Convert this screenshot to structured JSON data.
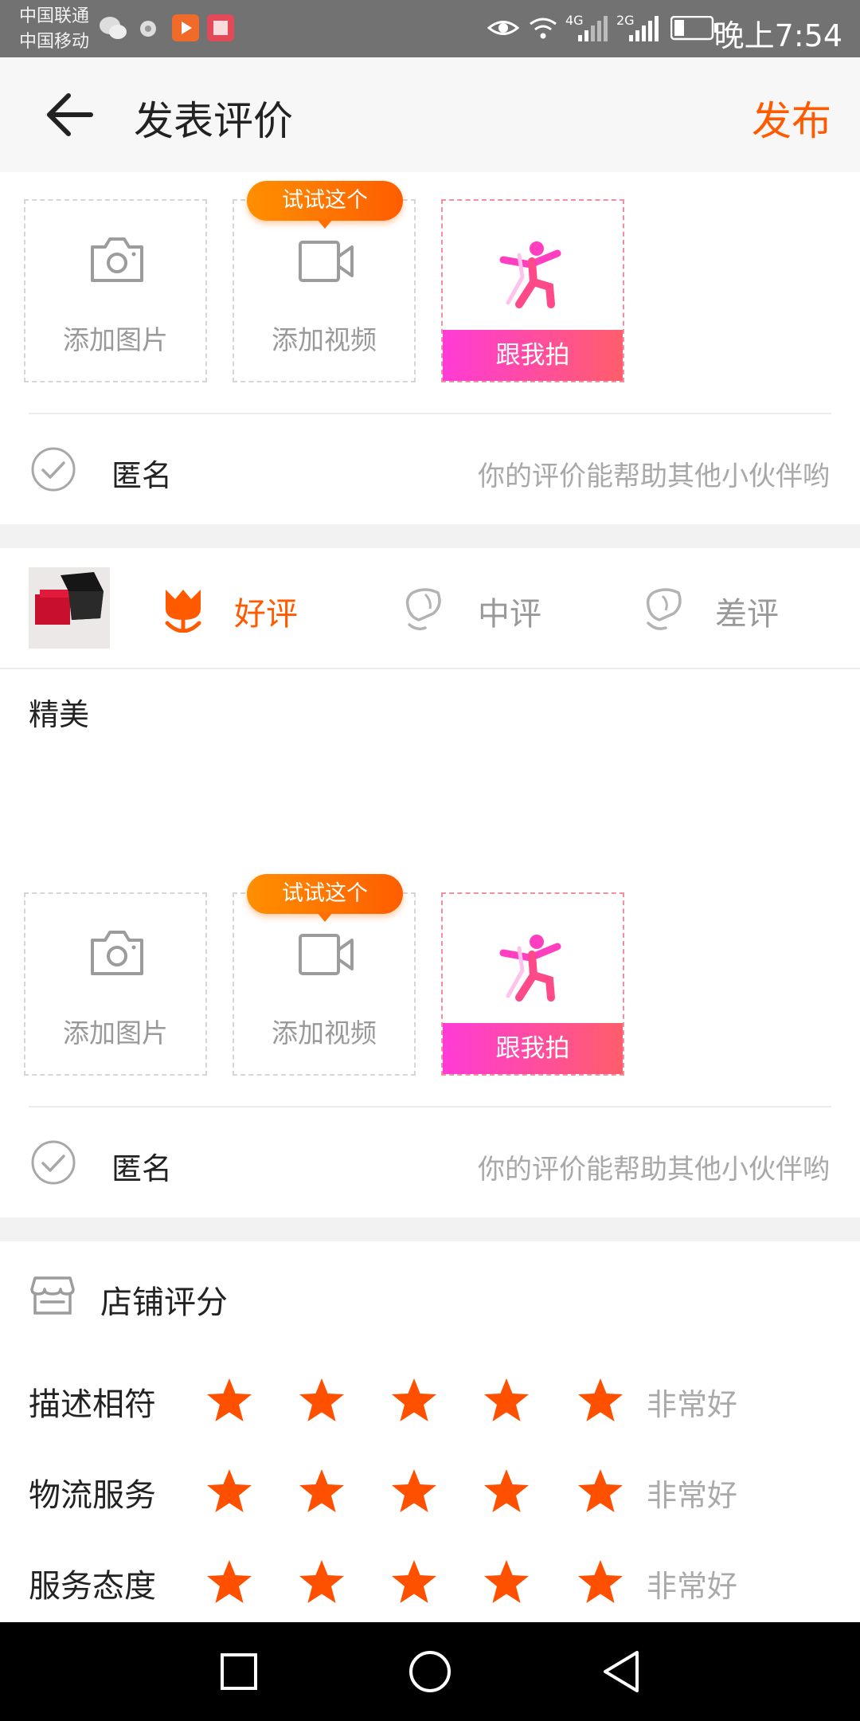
{
  "status_bar": {
    "carrier_1": "中国联通",
    "carrier_2": "中国移动",
    "network_1": "4G",
    "network_2": "2G",
    "time": "晚上7:54",
    "icons": [
      "wechat-icon",
      "browser-icon",
      "video-app-icon",
      "book-app-icon",
      "eye-icon",
      "wifi-icon",
      "signal-icon",
      "battery-icon"
    ]
  },
  "header": {
    "title": "发表评价",
    "publish": "发布"
  },
  "media": {
    "add_image": "添加图片",
    "add_video": "添加视频",
    "tooltip": "试试这个",
    "follow_me": "跟我拍"
  },
  "anonymous": {
    "label": "匿名",
    "hint": "你的评价能帮助其他小伙伴哟"
  },
  "rating": {
    "good": "好评",
    "neutral": "中评",
    "bad": "差评",
    "selected": "好评"
  },
  "comment": "精美",
  "store_rating": {
    "title": "店铺评分",
    "rows": [
      {
        "label": "描述相符",
        "stars": 5,
        "text": "非常好"
      },
      {
        "label": "物流服务",
        "stars": 5,
        "text": "非常好"
      },
      {
        "label": "服务态度",
        "stars": 5,
        "text": "非常好"
      }
    ]
  },
  "colors": {
    "accent": "#ff5a00",
    "follow_gradient_start": "#ff3bd6",
    "follow_gradient_end": "#ff5e6b",
    "star": "#ff5000"
  }
}
